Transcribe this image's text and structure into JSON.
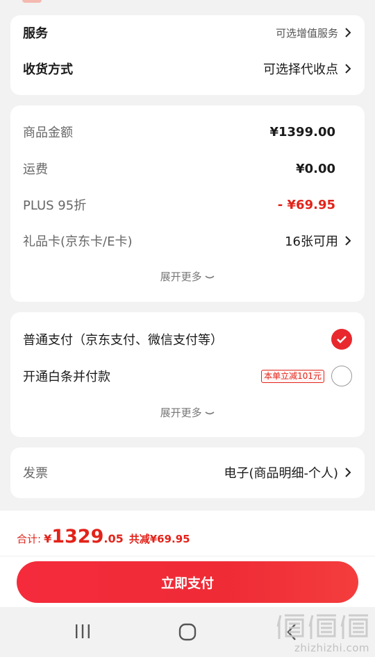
{
  "service_card": {
    "service_label": "服务",
    "service_hint": "可选增值服务",
    "delivery_label": "收货方式",
    "delivery_value": "可选择代收点"
  },
  "price_card": {
    "items": [
      {
        "label": "商品金额",
        "value": "¥1399.00"
      },
      {
        "label": "运费",
        "value": "¥0.00"
      },
      {
        "label": "PLUS 95折",
        "value": "- ¥69.95"
      },
      {
        "label": "礼品卡(京东卡/E卡)",
        "value": "16张可用"
      }
    ],
    "expand_label": "展开更多"
  },
  "payment_card": {
    "option1_label": "普通支付（京东支付、微信支付等）",
    "option2_label": "开通白条并付款",
    "option2_promo": "本单立减101元",
    "expand_label": "展开更多"
  },
  "invoice_card": {
    "label": "发票",
    "value": "电子(商品明细-个人)"
  },
  "footer": {
    "total_label": "合计:",
    "currency": "¥",
    "total_integer": "1329",
    "total_decimal": ".05",
    "saved_text": "共减¥69.95",
    "pay_button_label": "立即支付"
  },
  "watermark": {
    "text": "zhizhizhi.com"
  },
  "colors": {
    "accent_red": "#e2231a",
    "pay_button": "#f52b3c",
    "background": "#f2f2f2"
  }
}
